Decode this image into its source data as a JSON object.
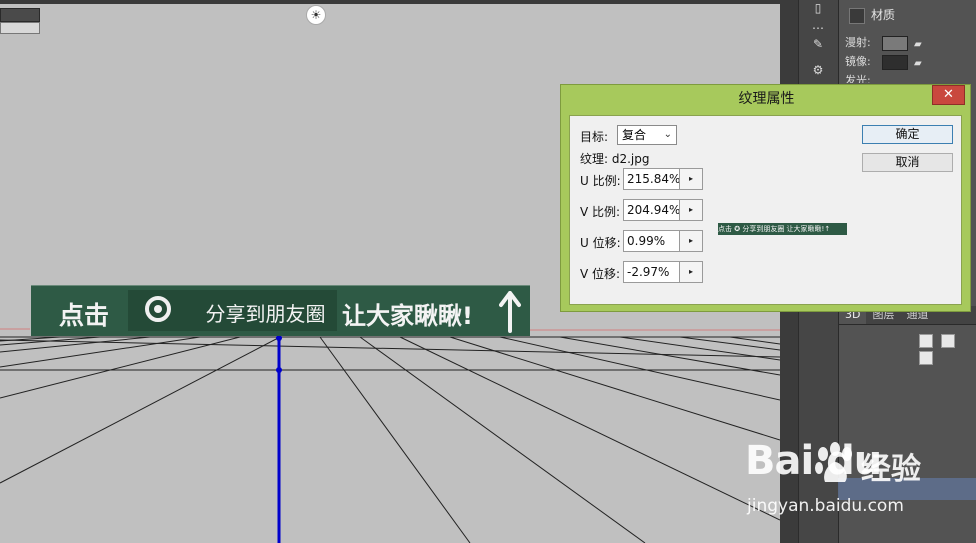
{
  "canvas": {
    "banner": {
      "click_text": "点击",
      "share_text": "分享到朋友圈",
      "all_text": "让大家瞅瞅!"
    }
  },
  "dialog": {
    "title": "纹理属性",
    "close_glyph": "✕",
    "target_label": "目标:",
    "target_value": "复合",
    "texture_label": "纹理: d2.jpg",
    "u_scale_label": "U 比例:",
    "u_scale_value": "215.84%",
    "v_scale_label": "V 比例:",
    "v_scale_value": "204.94%",
    "u_offset_label": "U 位移:",
    "u_offset_value": "0.99%",
    "v_offset_label": "V 位移:",
    "v_offset_value": "-2.97%",
    "ok_label": "确定",
    "cancel_label": "取消",
    "thumbnail_text": "点击 ✪ 分享到朋友圈 让大家瞅瞅!↑"
  },
  "panel": {
    "tab_label": "材质",
    "rows": [
      {
        "label": "漫射:",
        "color": "#7a7a7a"
      },
      {
        "label": "镜像:",
        "color": "#2e2e2e"
      },
      {
        "label": "发光:",
        "color": "#0a0a0a"
      }
    ],
    "lower_tabs": [
      "3D",
      "图层",
      "通道"
    ]
  },
  "watermark": {
    "brand": "Bai du",
    "product": "经验",
    "url": "jingyan.baidu.com"
  },
  "colors": {
    "dialog_frame": "#a7c95c",
    "close_button": "#c9483e",
    "banner_green": "#2e5a45",
    "axis_blue": "#0000cc"
  }
}
